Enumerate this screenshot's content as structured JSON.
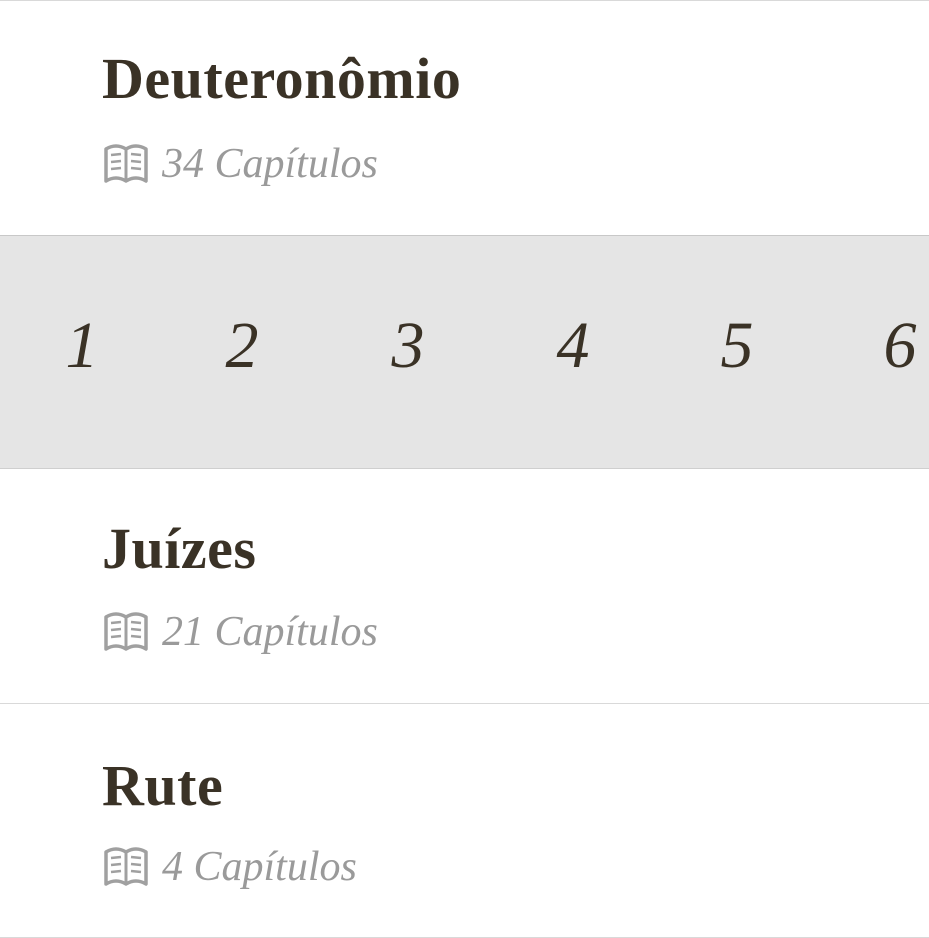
{
  "books": [
    {
      "title": "Deuteronômio",
      "chapters_label": "34 Capítulos",
      "icon": "book-open-icon"
    },
    {
      "title": "Juízes",
      "chapters_label": "21 Capítulos",
      "icon": "book-open-icon"
    },
    {
      "title": "Rute",
      "chapters_label": "4 Capítulos",
      "icon": "book-open-icon"
    }
  ],
  "chapter_grid": {
    "numbers": [
      "1",
      "2",
      "3",
      "4",
      "5",
      "6"
    ]
  },
  "colors": {
    "title_text": "#3a3226",
    "subtitle_text": "#9a9a9a",
    "strip_background": "#e5e5e5",
    "divider": "#d9d9d9"
  }
}
